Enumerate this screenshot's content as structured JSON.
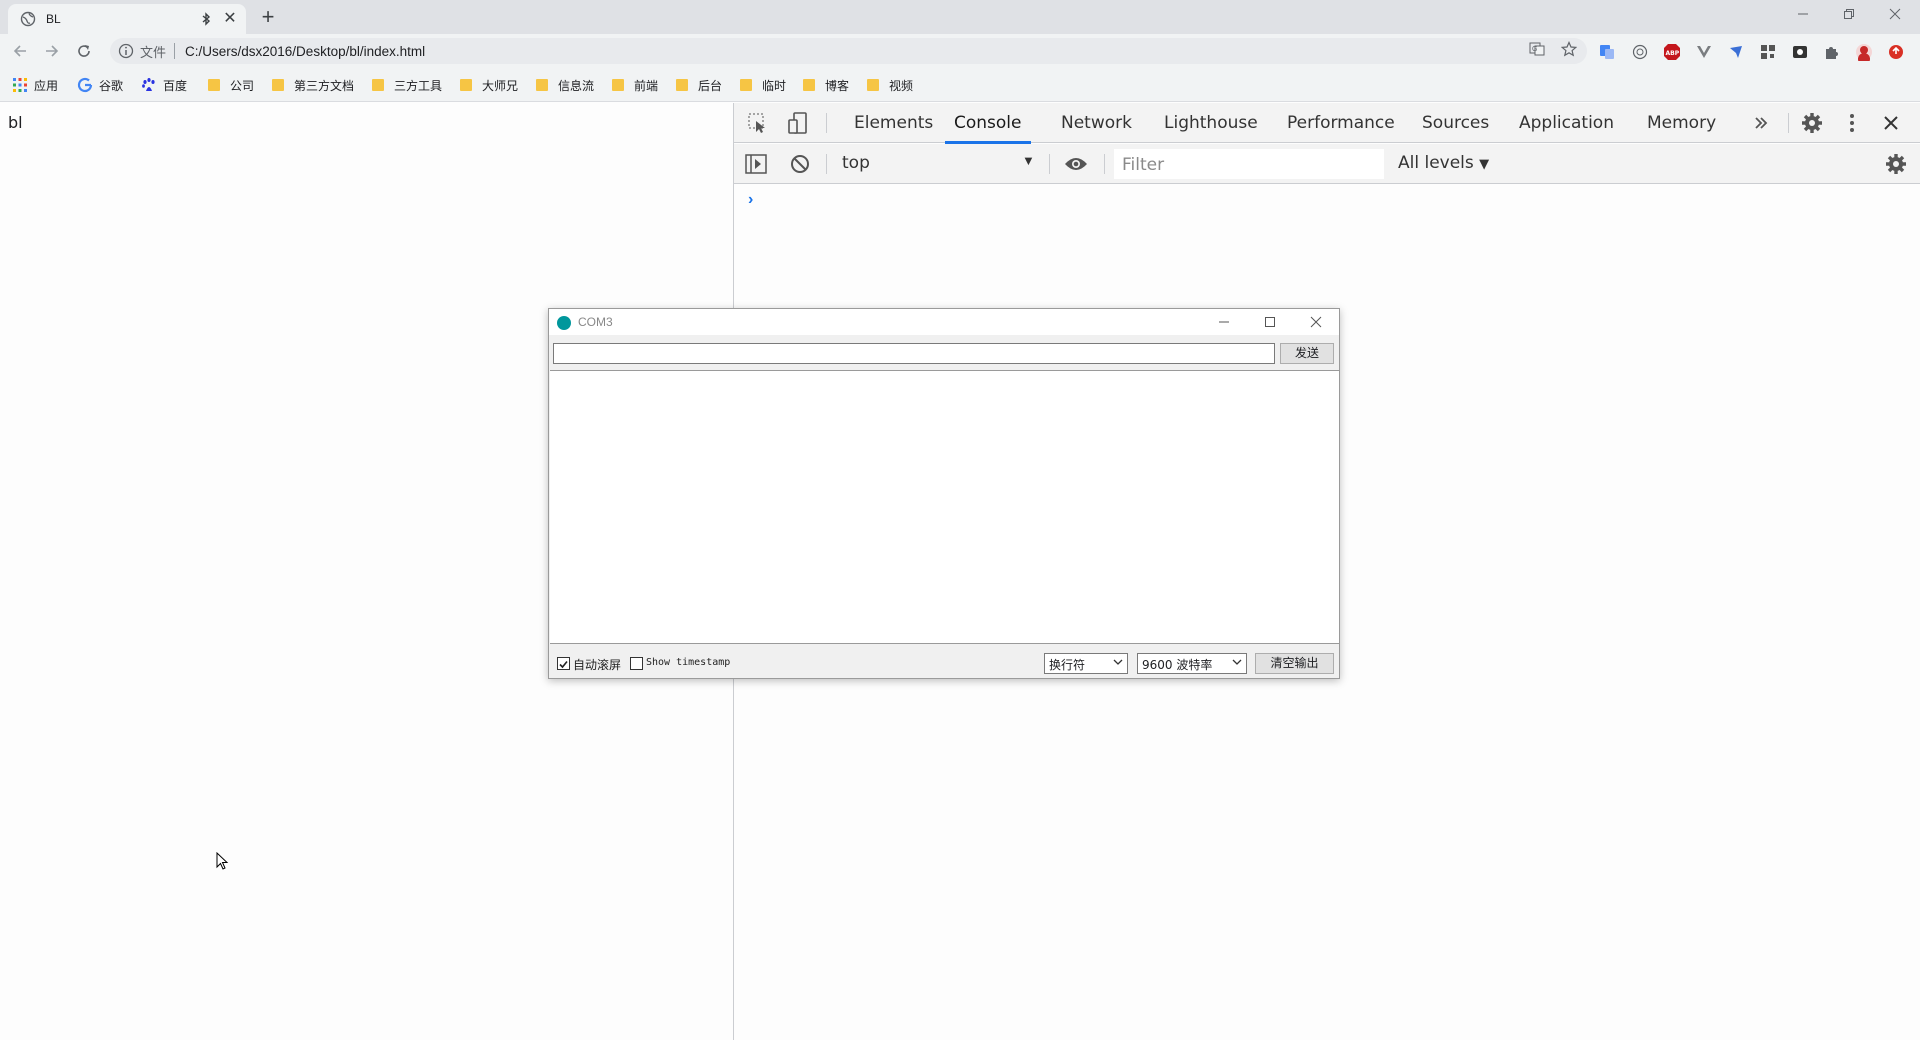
{
  "browser": {
    "tab": {
      "title": "BL"
    },
    "address": {
      "scheme_label": "文件",
      "url": "C:/Users/dsx2016/Desktop/bl/index.html"
    },
    "bookmarks": [
      {
        "label": "应用",
        "icon": "apps-grid-icon"
      },
      {
        "label": "谷歌",
        "icon": "google-icon"
      },
      {
        "label": "百度",
        "icon": "baidu-icon"
      },
      {
        "label": "公司",
        "icon": "folder-icon"
      },
      {
        "label": "第三方文档",
        "icon": "folder-icon"
      },
      {
        "label": "三方工具",
        "icon": "folder-icon"
      },
      {
        "label": "大师兄",
        "icon": "folder-icon"
      },
      {
        "label": "信息流",
        "icon": "folder-icon"
      },
      {
        "label": "前端",
        "icon": "folder-icon"
      },
      {
        "label": "后台",
        "icon": "folder-icon"
      },
      {
        "label": "临时",
        "icon": "folder-icon"
      },
      {
        "label": "博客",
        "icon": "folder-icon"
      },
      {
        "label": "视频",
        "icon": "folder-icon"
      }
    ]
  },
  "page": {
    "body_text": "bl"
  },
  "devtools": {
    "tabs": [
      "Elements",
      "Console",
      "Network",
      "Lighthouse",
      "Performance",
      "Sources",
      "Application",
      "Memory"
    ],
    "active_tab": "Console",
    "context": "top",
    "filter_placeholder": "Filter",
    "levels": "All levels"
  },
  "serial_monitor": {
    "title": "COM3",
    "send_label": "发送",
    "input_value": "",
    "autoscroll_label": "自动滚屏",
    "autoscroll_checked": true,
    "timestamp_label": "Show timestamp",
    "timestamp_checked": false,
    "line_ending": "换行符",
    "baud_rate": "9600 波特率",
    "clear_label": "清空输出"
  },
  "colors": {
    "accent": "#1a73e8",
    "arduino": "#00979c",
    "folder": "#f6c544"
  }
}
